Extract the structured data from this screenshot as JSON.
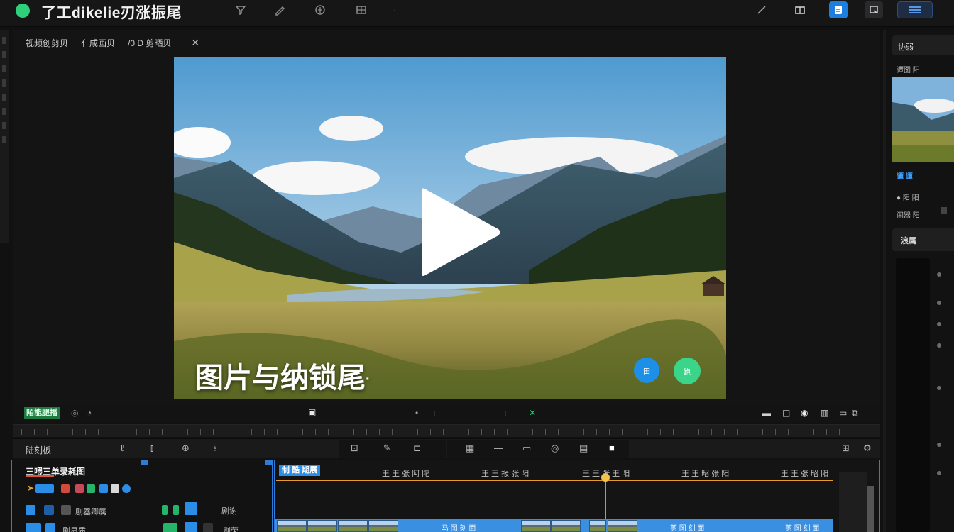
{
  "app": {
    "title": "了工dikelie刃涨振尾"
  },
  "breadcrumbs": [
    "视频创剪贝",
    "亻成画贝",
    "/0 D 剪晒贝"
  ],
  "preview": {
    "overlay_text": "图片与纳锁尾",
    "overlay_suffix": "·",
    "circle_buttons": [
      {
        "name": "blue",
        "label": "田",
        "color": "#1d8fe6"
      },
      {
        "name": "green",
        "label": "跑",
        "color": "#3bd58a"
      }
    ]
  },
  "transport": {
    "tag": "陌能腿播"
  },
  "edit_toolbar": {
    "label": "陆刻板"
  },
  "properties": {
    "title": "三喂三单录耗图",
    "rows": [
      {
        "label": "剧器卿属"
      },
      {
        "label": "剧显质"
      }
    ],
    "right_labels": [
      "剧谢",
      "刷荣"
    ]
  },
  "timeline": {
    "track_tag": "制 酷 期展",
    "time_labels": [
      "王 王 张 阿 陀",
      "王 王 报 张 阳",
      "王 王 张 王 阳",
      "王 王 昭 张 阳",
      "王 王 张 昭 阳"
    ],
    "clip_labels": [
      "马 图 刻 面",
      "剪 图 刻 面",
      "剪 图 刻 面"
    ]
  },
  "inspector": {
    "tab_label": "协弱",
    "subtitle": "谭图 阳",
    "blue_label": "谭 谭",
    "row1": "阳 阳",
    "row2": "闹器 阳",
    "section_label": "浪属"
  },
  "colors": {
    "accent_blue": "#1c7fe0",
    "accent_green": "#2fd07a",
    "playhead_knob": "#f2c24a",
    "track_line": "#e59a2d"
  },
  "icons": [
    "logo-dot-icon",
    "filter-icon",
    "draw-icon",
    "share-icon",
    "grid-icon",
    "pen-icon",
    "layout-icon",
    "doc-icon",
    "crop-icon",
    "menu-icon",
    "close-icon",
    "play-icon"
  ]
}
